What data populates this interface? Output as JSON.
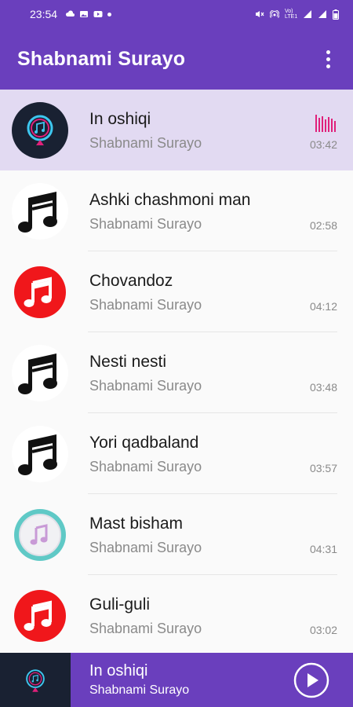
{
  "status": {
    "time": "23:54",
    "network_label": "Vo) LTE1",
    "battery_label": "B"
  },
  "app": {
    "title": "Shabnami Surayo"
  },
  "songs": [
    {
      "title": "In oshiqi",
      "artist": "Shabnami Surayo",
      "duration": "03:42",
      "icon": "music-pin-icon",
      "playing": true
    },
    {
      "title": "Ashki chashmoni man",
      "artist": "Shabnami Surayo",
      "duration": "02:58",
      "icon": "music-note-black-icon"
    },
    {
      "title": "Chovandoz",
      "artist": "Shabnami Surayo",
      "duration": "04:12",
      "icon": "music-note-red-icon"
    },
    {
      "title": "Nesti nesti",
      "artist": "Shabnami Surayo",
      "duration": "03:48",
      "icon": "music-note-black-icon"
    },
    {
      "title": "Yori qadbaland",
      "artist": "Shabnami Surayo",
      "duration": "03:57",
      "icon": "music-note-black-icon"
    },
    {
      "title": "Mast bisham",
      "artist": "Shabnami Surayo",
      "duration": "04:31",
      "icon": "itunes-note-icon"
    },
    {
      "title": "Guli-guli",
      "artist": "Shabnami Surayo",
      "duration": "03:02",
      "icon": "music-note-red-icon"
    }
  ],
  "player": {
    "title": "In oshiqi",
    "artist": "Shabnami Surayo",
    "icon": "music-pin-icon"
  },
  "colors": {
    "primary": "#6a3fbd",
    "active_row": "#e2daf2",
    "equalizer": "#e0207a",
    "red_note": "#f0171b"
  }
}
